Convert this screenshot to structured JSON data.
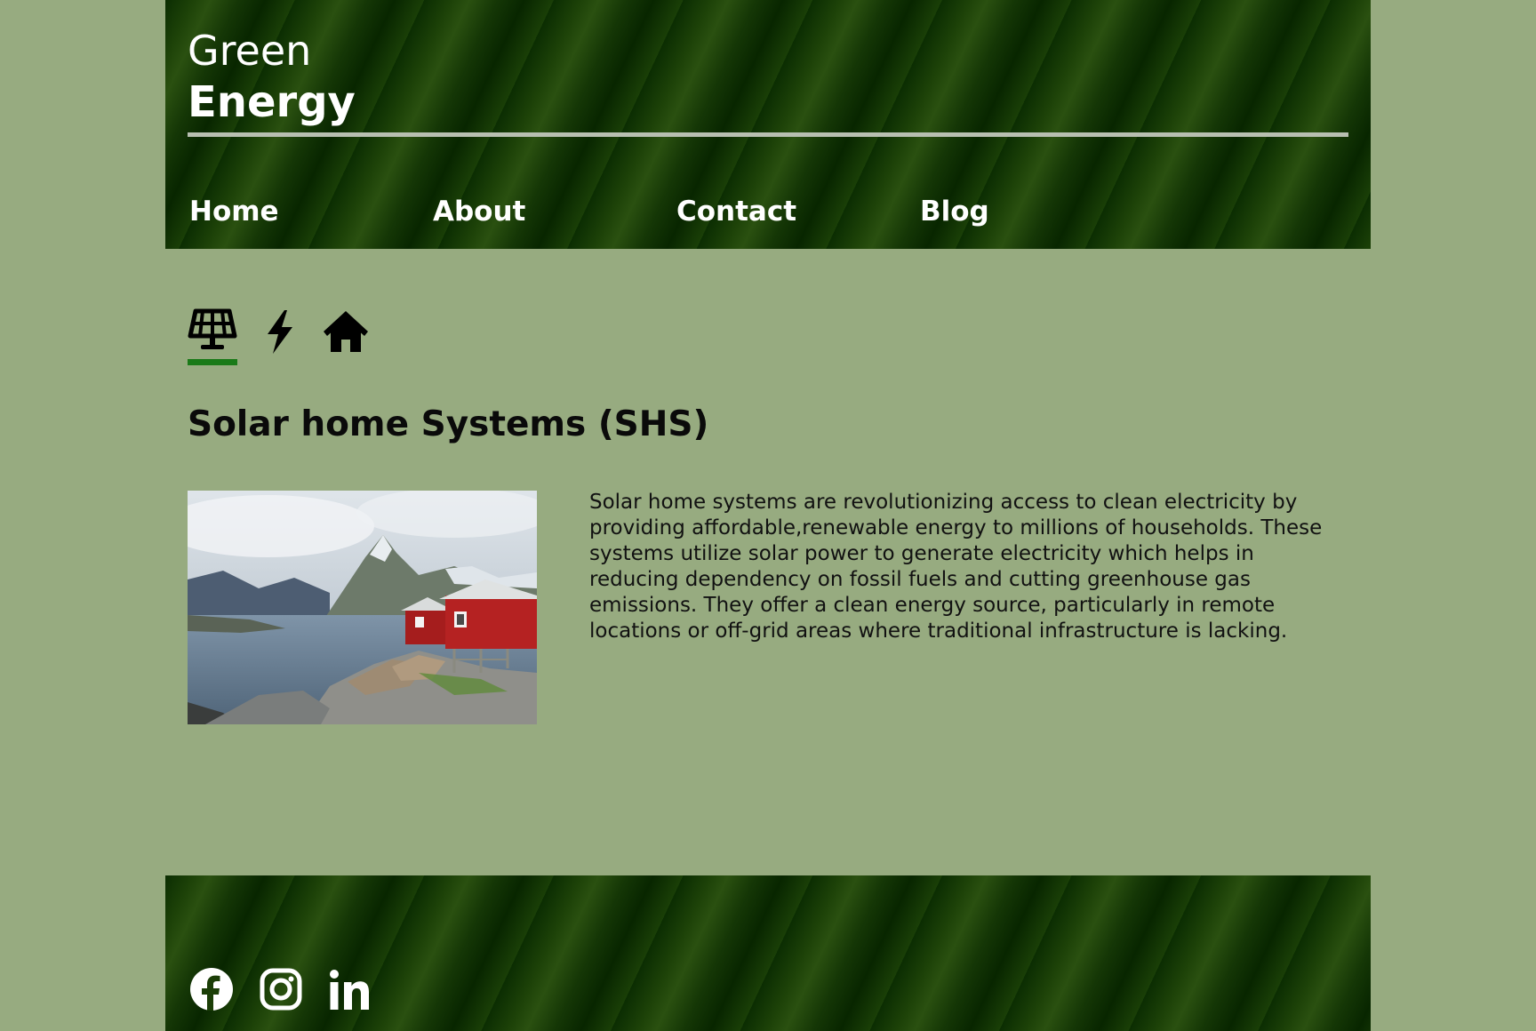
{
  "brand": {
    "line1": "Green",
    "line2": "Energy"
  },
  "nav": {
    "items": [
      {
        "label": "Home"
      },
      {
        "label": "About"
      },
      {
        "label": "Contact"
      },
      {
        "label": "Blog"
      }
    ]
  },
  "tabs": {
    "items": [
      {
        "icon": "solar-panel-icon",
        "active": true
      },
      {
        "icon": "lightning-bolt-icon",
        "active": false
      },
      {
        "icon": "house-icon",
        "active": false
      }
    ]
  },
  "section": {
    "title": "Solar home Systems (SHS)",
    "body": "Solar home systems are revolutionizing access to clean electricity by providing affordable,renewable energy to millions of households. These systems utilize solar power to generate electricity which helps in reducing dependency on fossil fuels and cutting greenhouse gas emissions. They offer a clean energy source, particularly in remote locations or off-grid areas where traditional infrastructure is lacking."
  },
  "footer": {
    "social": [
      {
        "icon": "facebook-icon"
      },
      {
        "icon": "instagram-icon"
      },
      {
        "icon": "linkedin-icon"
      }
    ]
  },
  "colors": {
    "page_background": "#97ab80",
    "header_green": "#1d4208",
    "accent_underline": "#1a7a18",
    "rule": "#b8bfb1"
  }
}
